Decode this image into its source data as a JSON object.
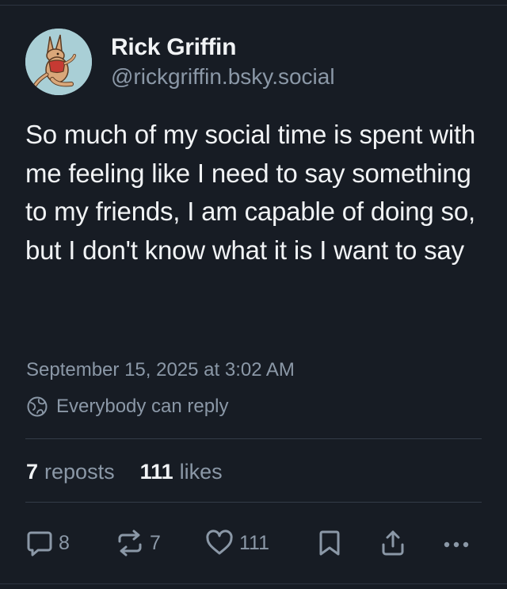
{
  "post": {
    "author": {
      "display_name": "Rick Griffin",
      "handle": "@rickgriffin.bsky.social"
    },
    "text": "So much of my social time is spent with me feeling like I need to say something to my friends, I am capable of doing so, but I don't know what it is I want to say",
    "timestamp": "September 15, 2025 at 3:02 AM",
    "reply_setting": "Everybody can reply"
  },
  "stats": {
    "reposts_count": "7",
    "reposts_label": "reposts",
    "likes_count": "111",
    "likes_label": "likes"
  },
  "actions": {
    "reply_count": "8",
    "repost_count": "7",
    "like_count": "111"
  },
  "colors": {
    "background": "#171c24",
    "text_primary": "#f1f3f5",
    "text_secondary": "#8b98a7",
    "divider": "#333c48",
    "avatar_bg": "#a9cfd6"
  },
  "icons": [
    "avatar-kangaroo",
    "globe-reply-icon",
    "reply-icon",
    "repost-icon",
    "like-icon",
    "bookmark-icon",
    "share-icon",
    "more-icon"
  ]
}
